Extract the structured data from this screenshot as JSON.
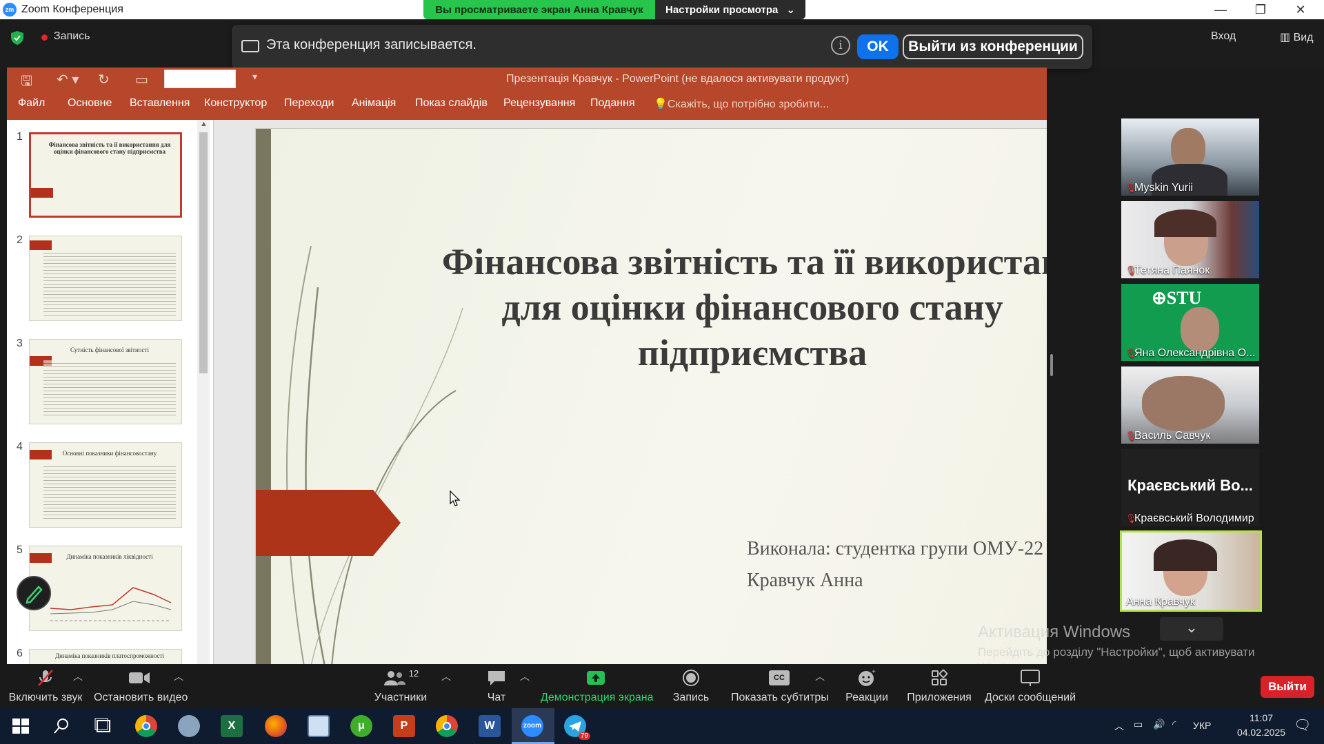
{
  "window": {
    "title": "Zoom Конференция",
    "viewing_banner": "Вы просматриваете экран Анна Кравчук",
    "view_options": "Настройки просмотра"
  },
  "recording": {
    "label": "Запись"
  },
  "notice": {
    "text": "Эта конференция записывается.",
    "ok_label": "OK",
    "leave_label": "Выйти из конференции"
  },
  "top_right": {
    "login": "Вход",
    "view": "Вид"
  },
  "powerpoint": {
    "title": "Презентація Кравчук - PowerPoint (не вдалося активувати продукт)",
    "menu": [
      "Файл",
      "Основне",
      "Вставлення",
      "Конструктор",
      "Переходи",
      "Анімація",
      "Показ слайдів",
      "Рецензування",
      "Подання"
    ],
    "tell_me": "Скажіть, що потрібно зробити...",
    "thumbnails": [
      {
        "num": "1",
        "title": "Фінансова звітність та її використання для оцінки фінансового стану підприємства"
      },
      {
        "num": "2",
        "title": ""
      },
      {
        "num": "3",
        "title": "Сутність фінансової звітності"
      },
      {
        "num": "4",
        "title": "Основні показники фінансовостану"
      },
      {
        "num": "5",
        "title": "Динаміка показників ліквідності"
      },
      {
        "num": "6",
        "title": "Динаміка показників платоспроможності"
      }
    ],
    "slide": {
      "title_lines": [
        "Фінансова звітність та її використан",
        "для оцінки фінансового стану",
        "підприємства"
      ],
      "author_line1": "Виконала: студентка групи ОМУ-22",
      "author_line2": "Кравчук Анна"
    }
  },
  "participants": [
    {
      "name": "Myskin Yurii",
      "muted": true
    },
    {
      "name": "Тетяна Паянок",
      "muted": true
    },
    {
      "name": "Яна Олександрівна О...",
      "muted": true
    },
    {
      "name": "Василь Савчук",
      "muted": true
    },
    {
      "name": "Краєвський Володимир",
      "muted": true,
      "big_label": "Краєвський Во..."
    },
    {
      "name": "Анна Кравчук",
      "muted": false,
      "active": true
    }
  ],
  "activation": {
    "title": "Активация Windows",
    "subtitle": "Перейдіть до розділу \"Настройки\", щоб активувати Windows."
  },
  "toolbar": {
    "unmute": "Включить звук",
    "video": "Остановить видео",
    "participants": "Участники",
    "participants_count": "12",
    "chat": "Чат",
    "share": "Демонстрация экрана",
    "record": "Запись",
    "captions": "Показать субтитры",
    "reactions": "Реакции",
    "apps": "Приложения",
    "whiteboards": "Доски сообщений",
    "leave": "Выйти"
  },
  "taskbar": {
    "lang": "УКР",
    "time": "11:07",
    "date": "04.02.2025",
    "telegram_badge": "79"
  },
  "colors": {
    "zoom_blue": "#0e72ed",
    "green": "#27c54b",
    "pp_red": "#b7472a",
    "leave_red": "#d8222a"
  }
}
